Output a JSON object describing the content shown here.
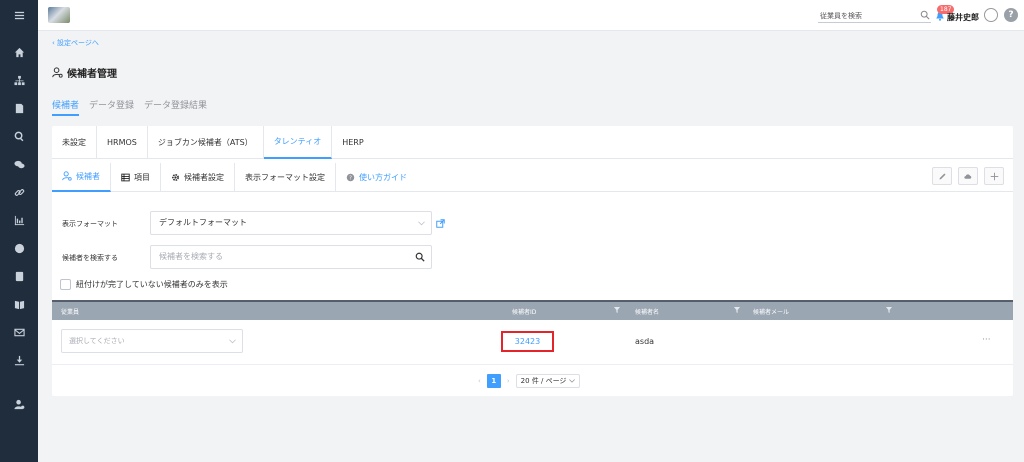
{
  "sidebar": {
    "icons": [
      "menu-icon",
      "home-icon",
      "org-chart-icon",
      "document-icon",
      "search-icon",
      "chat-icon",
      "link-icon",
      "chart-icon",
      "globe-icon",
      "contact-card-icon",
      "book-icon",
      "mail-icon",
      "download-icon",
      "user-settings-icon"
    ]
  },
  "header": {
    "search_placeholder": "従業員を検索",
    "notification_count": "187",
    "username": "藤井史郎",
    "help_label": "?"
  },
  "breadcrumb": {
    "back_label": "設定ページへ"
  },
  "page": {
    "title": "候補者管理"
  },
  "main_tabs": [
    {
      "label": "候補者",
      "active": true
    },
    {
      "label": "データ登録",
      "active": false
    },
    {
      "label": "データ登録結果",
      "active": false
    }
  ],
  "system_tabs": [
    {
      "label": "未設定",
      "active": false
    },
    {
      "label": "HRMOS",
      "active": false
    },
    {
      "label": "ジョブカン候補者（ATS）",
      "active": false
    },
    {
      "label": "タレンティオ",
      "active": true
    },
    {
      "label": "HERP",
      "active": false
    }
  ],
  "sub_tabs": [
    {
      "label": "候補者",
      "icon": "user-icon",
      "active": true
    },
    {
      "label": "項目",
      "icon": "list-icon",
      "active": false
    },
    {
      "label": "候補者設定",
      "icon": "gear-icon",
      "active": false
    },
    {
      "label": "表示フォーマット設定",
      "icon": "",
      "active": false
    },
    {
      "label": "使い方ガイド",
      "icon": "help-circle-icon",
      "active": false
    }
  ],
  "form": {
    "format_label": "表示フォーマット",
    "format_value": "デフォルトフォーマット",
    "search_label": "候補者を検索する",
    "search_placeholder": "候補者を検索する",
    "checkbox_label": "紐付けが完了していない候補者のみを表示"
  },
  "table": {
    "columns": [
      "従業員",
      "候補者ID",
      "候補者名",
      "候補者メール"
    ],
    "rows": [
      {
        "employee_placeholder": "選択してください",
        "candidate_id": "32423",
        "candidate_name": "asda",
        "candidate_email": "",
        "more": "···"
      }
    ]
  },
  "pagination": {
    "prev": "‹",
    "current_page": "1",
    "next": "›",
    "page_size": "20 件 / ページ"
  },
  "colors": {
    "accent": "#409eff",
    "sidebar_bg": "#1f2d3d",
    "highlight_box": "#e3242b",
    "badge": "#f56c6c"
  }
}
